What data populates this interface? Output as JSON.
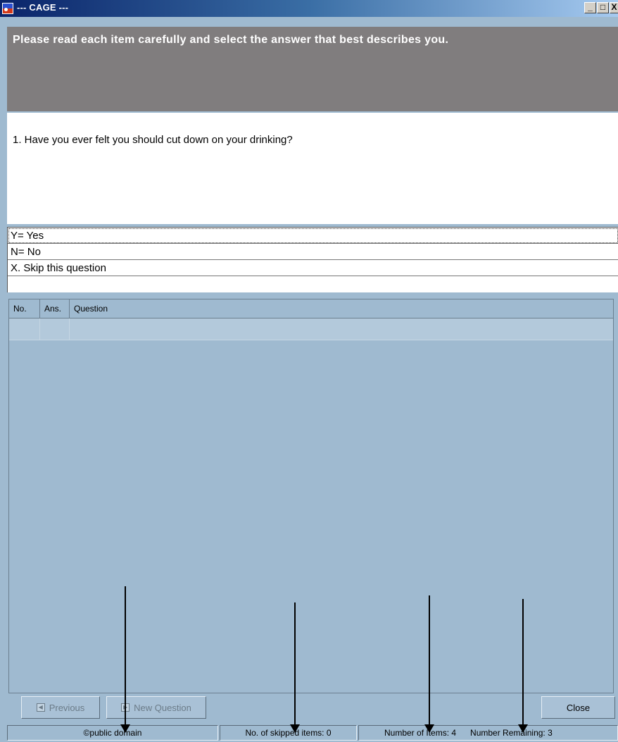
{
  "window": {
    "title": "--- CAGE ---",
    "controls": [
      "minimize-icon",
      "maximize-icon",
      "close-icon"
    ]
  },
  "instructions": "Please read each item carefully and select the answer that best describes you.",
  "question": "1.  Have you ever felt you should cut down on your drinking?",
  "answers": [
    {
      "label": "Y= Yes",
      "selected": true
    },
    {
      "label": "N= No",
      "selected": false
    },
    {
      "label": "X. Skip this question",
      "selected": false
    }
  ],
  "grid": {
    "columns": [
      "No.",
      "Ans.",
      "Question"
    ],
    "rows": [
      [
        "",
        "",
        ""
      ]
    ]
  },
  "buttons": {
    "previous": "Previous",
    "new_question": "New Question",
    "close": "Close"
  },
  "status": {
    "copyright": "©public domain",
    "skipped": "No. of skipped items: 0",
    "items": "Number of Items:  4",
    "remaining": "Number Remaining:  3"
  },
  "colors": {
    "background": "#9fbad0",
    "header": "#807d7e",
    "title_gradient_start": "#0a246a"
  }
}
